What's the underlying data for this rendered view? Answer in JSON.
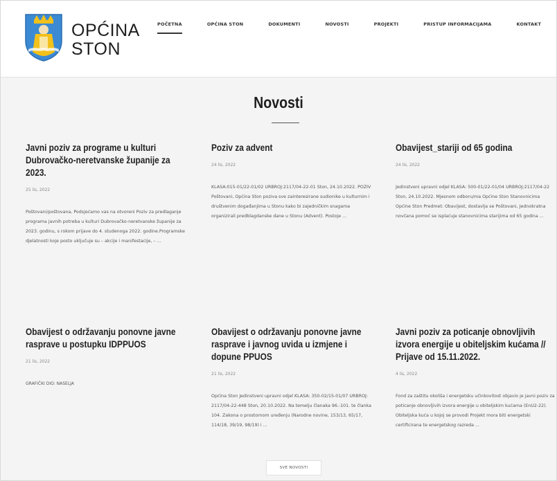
{
  "header": {
    "logo_line1": "OPĆINA",
    "logo_line2": "STON",
    "nav": [
      "POČETNA",
      "OPĆINA STON",
      "DOKUMENTI",
      "NOVOSTI",
      "PROJEKTI",
      "PRISTUP INFORMACIJAMA",
      "KONTAKT"
    ]
  },
  "main": {
    "title": "Novosti",
    "more_label": "SVE NOVOSTI",
    "cards": [
      {
        "title": "Javni poziv za programe u kulturi Dubrovačko-neretvanske županije za 2023.",
        "date": "25 lis, 2022",
        "excerpt": "Poštovani/poštovana, Podsjećamo vas na otvoreni Poziv za predlaganje programa javnih potreba u kulturi Dubrovačko-neretvanske županije za 2023. godinu, s rokom prijave do 4. studenoga 2022. godine.Programske djelatnosti koje posto uključuje su – akcije i manifestacije, – ..."
      },
      {
        "title": "Poziv za advent",
        "date": "24 lis, 2022",
        "excerpt": "KLASA:015-01/22-01/02 URBROJ:2117/04-22-01 Ston, 24.10.2022. POZIV Poštovani, Općina Ston poziva sve zainteresirane sudionike u kulturnim i društvenim događanjima u Stonu kako bi zajedničkim snagama organizirali predblagdanske dane u Stonu (Advent). Postoje ..."
      },
      {
        "title": "Obavijest_stariji od 65 godina",
        "date": "24 lis, 2022",
        "excerpt": "Jedinstveni upravni odjel KLASA: 500-01/22-01/04 URBROJ:2117/04-22 Ston, 24.10.2022. Mjesnom odboru/ma Općine Ston Stanovnicima Općine Ston Predmet: Obavijest, dostavlja se Poštovani, Jednokratna novčana pomoć se isplaćuje stanovnicima starijima od 65 godina ..."
      },
      {
        "title": "Obavijest o održavanju ponovne javne rasprave u postupku IDPPUOS",
        "date": "21 lis, 2022",
        "excerpt": "GRAFIČKI DIO: NASELJA"
      },
      {
        "title": "Obavijest o održavanju ponovne javne rasprave i javnog uvida u izmjene i dopune PPUOS",
        "date": "21 lis, 2022",
        "excerpt": "Općina Ston Jedinstveni upravni odjel KLASA: 350-02/15-01/07 URBROJ: 2117/04-22-448 Ston, 20.10.2022. Na temelju članaka 96.-101. te članka 104. Zakona o prostornom uređenju (Narodne novine, 153/13, 65/17, 114/18, 39/19, 98/19) i ..."
      },
      {
        "title": "Javni poziv za poticanje obnovljivih izvora energije u obiteljskim kućama // Prijave od 15.11.2022.",
        "date": "4 lis, 2022",
        "excerpt": "Fond za zaštitu okoliša i energetsku učinkovitost objavio je javni poziv za poticanje obnovljivih izvora energije u obiteljskim kućama (EnU2-22). Obiteljska kuća u kojoj se provodi Projekt mora biti energetski certificirana te energetskog razreda ..."
      }
    ]
  },
  "colors": {
    "header_bg": "#ffffff",
    "page_bg": "#f4f4f4",
    "crest_blue": "#3b8ad3",
    "crest_gold": "#f3c11b"
  }
}
